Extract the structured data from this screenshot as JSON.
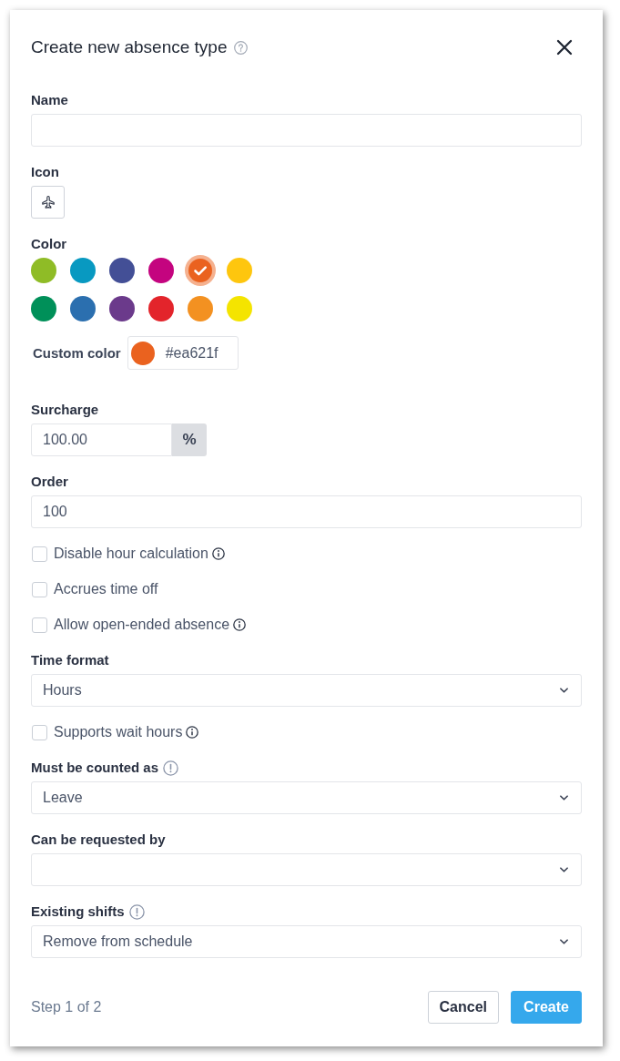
{
  "dialog": {
    "title": "Create new absence type",
    "help": true
  },
  "fields": [
    {
      "kind": "text",
      "label": "Name"
    },
    {
      "kind": "icon",
      "label": "Icon"
    },
    {
      "kind": "color",
      "label": "Color",
      "swatches": [
        {
          "color": "#8fbc26",
          "selected": false
        },
        {
          "color": "#0899c1",
          "selected": false
        },
        {
          "color": "#434f96",
          "selected": false
        },
        {
          "color": "#c4047f",
          "selected": false
        },
        {
          "color": "#ea621f",
          "selected": true
        },
        {
          "color": "#fec60e",
          "selected": false
        },
        {
          "color": "#009059",
          "selected": false
        },
        {
          "color": "#2b6faf",
          "selected": false
        },
        {
          "color": "#6b3a8b",
          "selected": false
        },
        {
          "color": "#e3242b",
          "selected": false
        },
        {
          "color": "#f39121",
          "selected": false
        },
        {
          "color": "#f4e400",
          "selected": false
        }
      ],
      "custom": {
        "label": "Custom color",
        "color": "#ea621f",
        "value": "#ea621f"
      }
    },
    {
      "kind": "unit",
      "label": "Surcharge",
      "value": "100.00",
      "unit": "%"
    },
    {
      "kind": "text",
      "label": "Order",
      "value": "100"
    },
    {
      "kind": "checkbox",
      "label": "Disable hour calculation",
      "checked": false,
      "info": true
    },
    {
      "kind": "checkbox",
      "label": "Accrues time off",
      "checked": false
    },
    {
      "kind": "checkbox",
      "label": "Allow open-ended absence",
      "checked": false,
      "info": true
    },
    {
      "kind": "select",
      "label": "Time format",
      "value": "Hours"
    },
    {
      "kind": "checkbox",
      "label": "Supports wait hours",
      "checked": false,
      "info": true
    },
    {
      "kind": "select",
      "label": "Must be counted as",
      "value": "Leave",
      "alert": true
    },
    {
      "kind": "select",
      "label": "Can be requested by"
    },
    {
      "kind": "select",
      "label": "Existing shifts",
      "value": "Remove from schedule",
      "alert": true
    }
  ],
  "footer": {
    "step": "Step 1 of 2",
    "buttons": [
      {
        "label": "Cancel",
        "kind": "secondary"
      },
      {
        "label": "Create",
        "kind": "primary"
      }
    ]
  }
}
